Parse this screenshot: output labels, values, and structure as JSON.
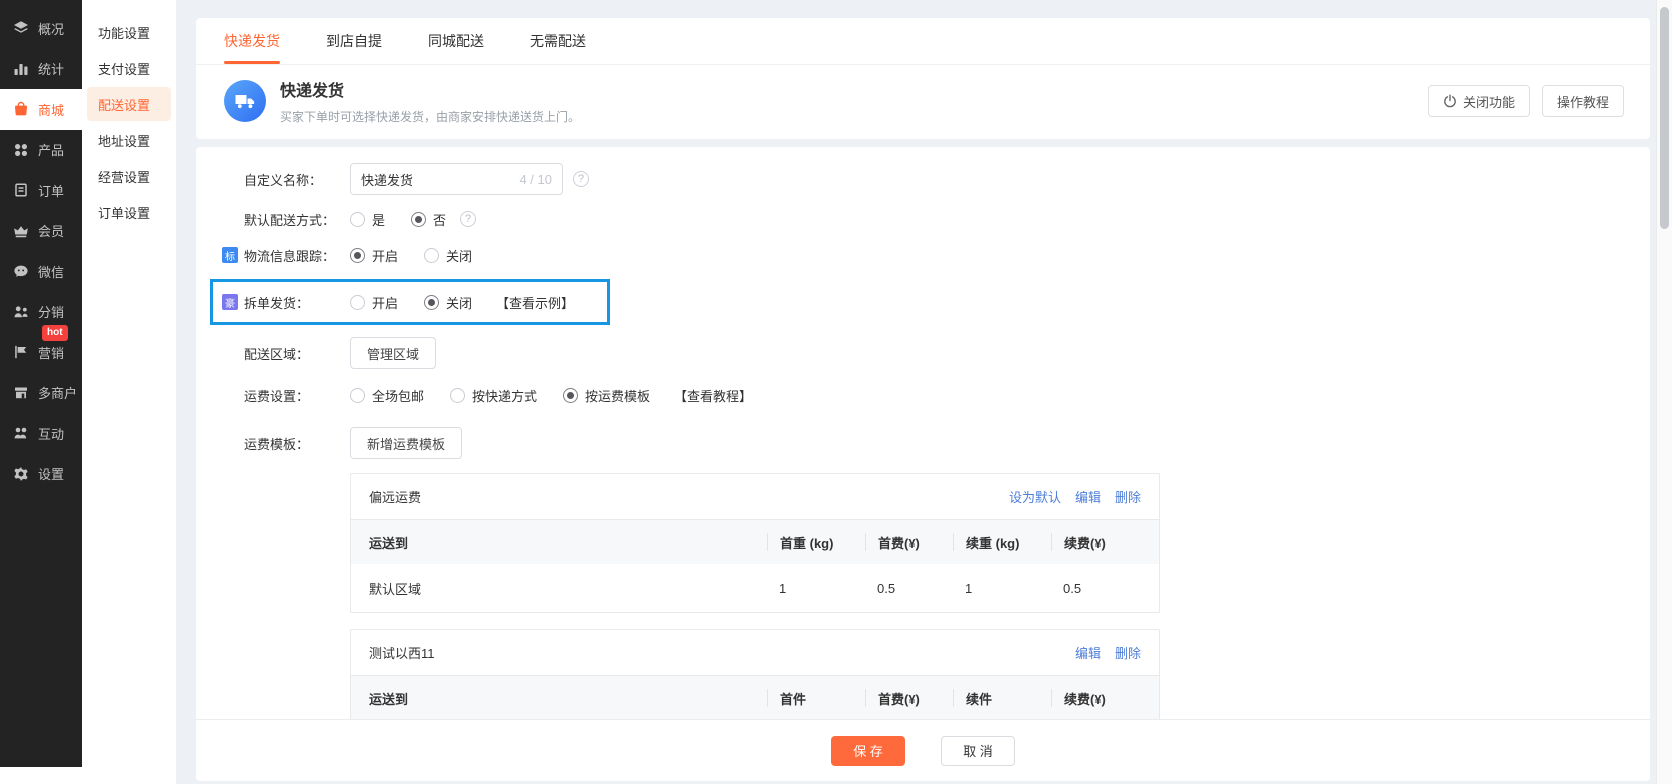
{
  "colors": {
    "accent": "#ff6633",
    "highlight_box": "#1697e3",
    "link_blue": "#4d7dd8",
    "tag_blue": "#3d8af2",
    "tag_purple": "#7a77ee",
    "hot_badge": "#f5413d",
    "save_button": "#ff6a3c",
    "sidebar_dark": "#232323"
  },
  "icons": {
    "question": "?"
  },
  "sidebar": {
    "items": [
      {
        "label": "概况"
      },
      {
        "label": "统计"
      },
      {
        "label": "商城",
        "active": true
      },
      {
        "label": "产品"
      },
      {
        "label": "订单"
      },
      {
        "label": "会员"
      },
      {
        "label": "微信"
      },
      {
        "label": "分销"
      },
      {
        "label": "营销",
        "badge": "hot"
      },
      {
        "label": "多商户"
      },
      {
        "label": "互动"
      },
      {
        "label": "设置"
      }
    ]
  },
  "submenu": {
    "items": [
      {
        "label": "功能设置"
      },
      {
        "label": "支付设置"
      },
      {
        "label": "配送设置",
        "active": true
      },
      {
        "label": "地址设置"
      },
      {
        "label": "经营设置"
      },
      {
        "label": "订单设置"
      }
    ]
  },
  "tabs": [
    {
      "label": "快递发货",
      "active": true
    },
    {
      "label": "到店自提"
    },
    {
      "label": "同城配送"
    },
    {
      "label": "无需配送"
    }
  ],
  "header": {
    "title": "快递发货",
    "subtitle": "买家下单时可选择快递发货，由商家安排快递送货上门。",
    "close_button": "关闭功能",
    "tutorial_button": "操作教程"
  },
  "form": {
    "name": {
      "label": "自定义名称：",
      "value": "快递发货",
      "counter": "4 / 10"
    },
    "default_method": {
      "label": "默认配送方式：",
      "options": [
        "是",
        "否"
      ],
      "selected": "否"
    },
    "tracking": {
      "tag": "标",
      "label": "物流信息跟踪：",
      "options": [
        "开启",
        "关闭"
      ],
      "selected": "开启"
    },
    "split": {
      "tag": "豪",
      "label": "拆单发货：",
      "options": [
        "开启",
        "关闭"
      ],
      "selected": "关闭",
      "example_link": "【查看示例】"
    },
    "area": {
      "label": "配送区域：",
      "button": "管理区域"
    },
    "freight": {
      "label": "运费设置：",
      "options": [
        "全场包邮",
        "按快递方式",
        "按运费模板"
      ],
      "selected": "按运费模板",
      "tutorial_link": "【查看教程】"
    },
    "template": {
      "label": "运费模板：",
      "button": "新增运费模板"
    }
  },
  "tables": [
    {
      "title": "偏远运费",
      "actions": [
        "设为默认",
        "编辑",
        "删除"
      ],
      "headers": [
        "运送到",
        "首重 (kg)",
        "首费(¥)",
        "续重 (kg)",
        "续费(¥)"
      ],
      "rows": [
        {
          "cells": [
            "默认区域",
            "1",
            "0.5",
            "1",
            "0.5"
          ]
        }
      ]
    },
    {
      "title": "测试以西11",
      "actions": [
        "编辑",
        "删除"
      ],
      "headers": [
        "运送到",
        "首件",
        "首费(¥)",
        "续件",
        "续费(¥)"
      ],
      "rows": []
    }
  ],
  "footer": {
    "save": "保 存",
    "cancel": "取 消"
  }
}
